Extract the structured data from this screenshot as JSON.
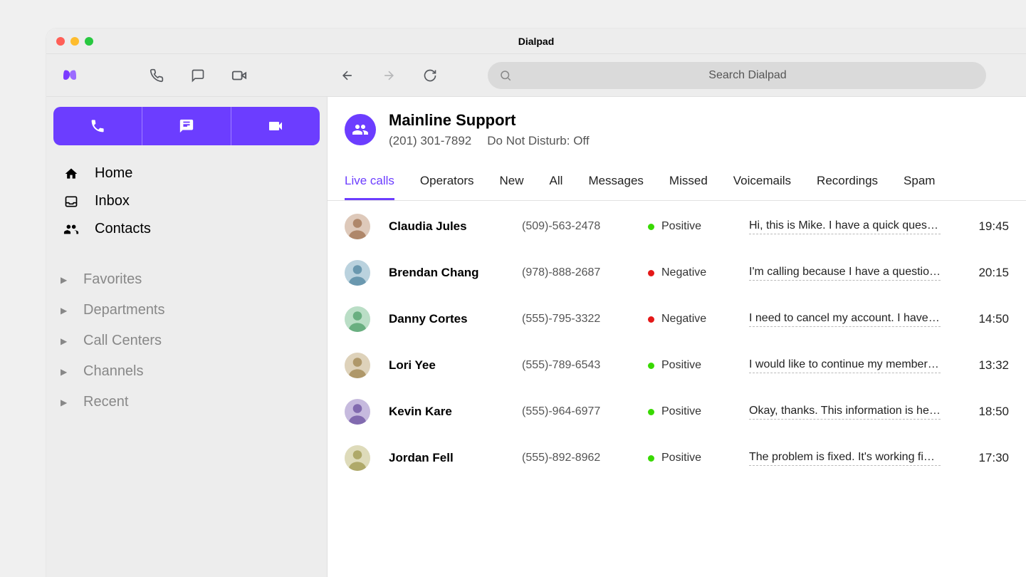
{
  "window": {
    "title": "Dialpad"
  },
  "toolbar": {
    "search_placeholder": "Search Dialpad"
  },
  "sidebar": {
    "nav": [
      {
        "icon": "home-icon",
        "label": "Home"
      },
      {
        "icon": "inbox-icon",
        "label": "Inbox"
      },
      {
        "icon": "contacts-icon",
        "label": "Contacts"
      }
    ],
    "folders": [
      {
        "label": "Favorites"
      },
      {
        "label": "Departments"
      },
      {
        "label": "Call Centers"
      },
      {
        "label": "Channels"
      },
      {
        "label": "Recent"
      }
    ]
  },
  "header": {
    "title": "Mainline Support",
    "phone": "(201) 301-7892",
    "dnd": "Do Not Disturb: Off"
  },
  "tabs": [
    {
      "label": "Live calls",
      "active": true
    },
    {
      "label": "Operators"
    },
    {
      "label": "New"
    },
    {
      "label": "All"
    },
    {
      "label": "Messages"
    },
    {
      "label": "Missed"
    },
    {
      "label": "Voicemails"
    },
    {
      "label": "Recordings"
    },
    {
      "label": "Spam"
    }
  ],
  "calls": [
    {
      "name": "Claudia Jules",
      "phone": "(509)-563-2478",
      "sentiment": "Positive",
      "transcript": "Hi, this is Mike. I have a quick question…",
      "time": "19:45",
      "avatar_hue": 25
    },
    {
      "name": "Brendan Chang",
      "phone": "(978)-888-2687",
      "sentiment": "Negative",
      "transcript": "I'm calling because I have a question…",
      "time": "20:15",
      "avatar_hue": 200
    },
    {
      "name": "Danny Cortes",
      "phone": "(555)-795-3322",
      "sentiment": "Negative",
      "transcript": "I need to cancel my account. I have…",
      "time": "14:50",
      "avatar_hue": 140
    },
    {
      "name": "Lori Yee",
      "phone": "(555)-789-6543",
      "sentiment": "Positive",
      "transcript": "I would like to continue my membership…",
      "time": "13:32",
      "avatar_hue": 40
    },
    {
      "name": "Kevin Kare",
      "phone": "(555)-964-6977",
      "sentiment": "Positive",
      "transcript": "Okay, thanks. This information is helpful…",
      "time": "18:50",
      "avatar_hue": 260
    },
    {
      "name": "Jordan Fell",
      "phone": "(555)-892-8962",
      "sentiment": "Positive",
      "transcript": "The problem is fixed. It's working fine…",
      "time": "17:30",
      "avatar_hue": 55
    }
  ]
}
